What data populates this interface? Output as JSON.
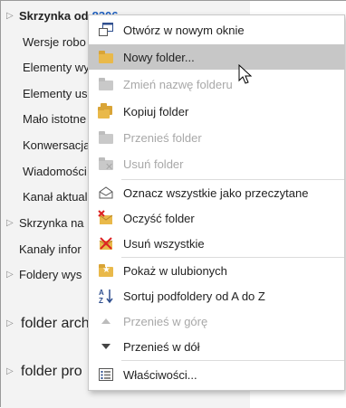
{
  "folder_pane": {
    "items": [
      {
        "label": "Skrzynka od",
        "count": "8306"
      },
      {
        "label": "Wersje robo"
      },
      {
        "label": "Elementy wy"
      },
      {
        "label": "Elementy us"
      },
      {
        "label": "Mało istotne"
      },
      {
        "label": "Konwersacja"
      },
      {
        "label": "Wiadomości"
      },
      {
        "label": "Kanał aktual"
      },
      {
        "label": "Skrzynka na"
      },
      {
        "label": "Kanały infor"
      },
      {
        "label": "Foldery wys"
      },
      {
        "label": "folder arch"
      },
      {
        "label": "folder pro"
      }
    ]
  },
  "context_menu": {
    "items": [
      {
        "label": "Otwórz w nowym oknie",
        "icon": "new-window-icon",
        "enabled": true
      },
      {
        "label": "Nowy folder...",
        "icon": "new-folder-icon",
        "enabled": true,
        "highlighted": true
      },
      {
        "label": "Zmień nazwę folderu",
        "icon": "rename-folder-icon",
        "enabled": false
      },
      {
        "label": "Kopiuj folder",
        "icon": "copy-folder-icon",
        "enabled": true
      },
      {
        "label": "Przenieś folder",
        "icon": "move-folder-icon",
        "enabled": false
      },
      {
        "label": "Usuń folder",
        "icon": "delete-folder-icon",
        "enabled": false
      },
      {
        "label": "Oznacz wszystkie jako przeczytane",
        "icon": "mark-read-icon",
        "enabled": true
      },
      {
        "label": "Oczyść folder",
        "icon": "clean-folder-icon",
        "enabled": true
      },
      {
        "label": "Usuń wszystkie",
        "icon": "delete-all-icon",
        "enabled": true
      },
      {
        "label": "Pokaż w ulubionych",
        "icon": "favorite-folder-icon",
        "enabled": true
      },
      {
        "label": "Sortuj podfoldery od A do Z",
        "icon": "sort-az-icon",
        "enabled": true
      },
      {
        "label": "Przenieś w górę",
        "icon": "move-up-icon",
        "enabled": false
      },
      {
        "label": "Przenieś w dół",
        "icon": "move-down-icon",
        "enabled": true
      },
      {
        "label": "Właściwości...",
        "icon": "properties-icon",
        "enabled": true
      }
    ]
  },
  "colors": {
    "pane_bg": "#f3f3f3",
    "highlight_bg": "#c7c7c7",
    "disabled_text": "#a8a8a8",
    "folder_yellow": "#e9b94a",
    "accent_blue": "#1f5fbf"
  }
}
